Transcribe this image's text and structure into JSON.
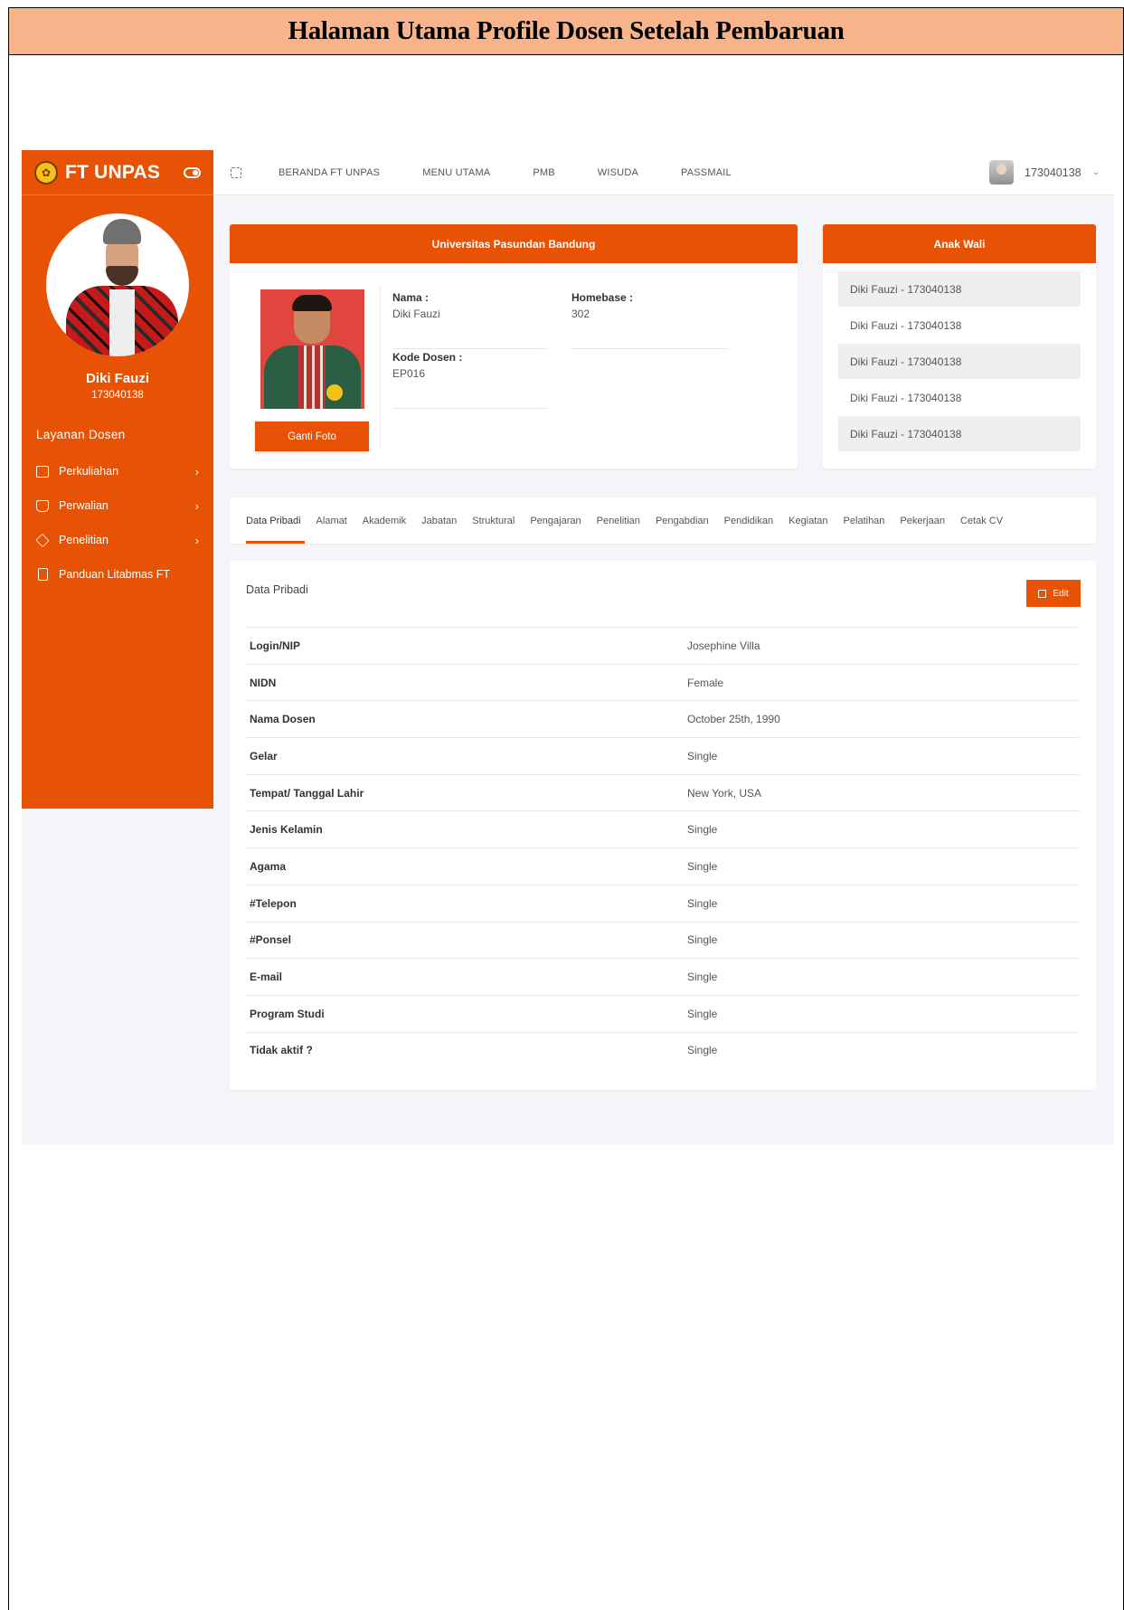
{
  "caption": "Halaman Utama Profile Dosen Setelah Pembaruan",
  "sidebar": {
    "brand": "FT UNPAS",
    "user_name": "Diki Fauzi",
    "user_id": "173040138",
    "section_title": "Layanan Dosen",
    "items": [
      {
        "label": "Perkuliahan",
        "icon": "monitor-icon",
        "has_submenu": true
      },
      {
        "label": "Perwalian",
        "icon": "inbox-icon",
        "has_submenu": true
      },
      {
        "label": "Penelitian",
        "icon": "layers-icon",
        "has_submenu": true
      },
      {
        "label": "Panduan Litabmas FT",
        "icon": "clipboard-icon",
        "has_submenu": false
      }
    ],
    "chevron": "›"
  },
  "topbar": {
    "nav": [
      "BERANDA FT UNPAS",
      "MENU UTAMA",
      "PMB",
      "WISUDA",
      "PASSMAIL"
    ],
    "user_id": "173040138",
    "caret": "⌄"
  },
  "univ_card": {
    "title": "Universitas Pasundan Bandung",
    "photo_button": "Ganti Foto",
    "fields": {
      "nama_label": "Nama :",
      "nama_value": "Diki Fauzi",
      "homebase_label": "Homebase :",
      "homebase_value": "302",
      "kode_label": "Kode Dosen :",
      "kode_value": "EP016"
    }
  },
  "wali_card": {
    "title": "Anak Wali",
    "items": [
      "Diki Fauzi - 173040138",
      "Diki Fauzi - 173040138",
      "Diki Fauzi - 173040138",
      "Diki Fauzi - 173040138",
      "Diki Fauzi - 173040138"
    ]
  },
  "tabs": [
    "Data Pribadi",
    "Alamat",
    "Akademik",
    "Jabatan",
    "Struktural",
    "Pengajaran",
    "Penelitian",
    "Pengabdian",
    "Pendidikan",
    "Kegiatan",
    "Pelatihan",
    "Pekerjaan",
    "Cetak CV"
  ],
  "active_tab": 0,
  "data_card": {
    "title": "Data Pribadi",
    "edit_label": "Edit",
    "rows": [
      {
        "key": "Login/NIP",
        "value": "Josephine Villa"
      },
      {
        "key": "NIDN",
        "value": "Female"
      },
      {
        "key": "Nama Dosen",
        "value": "October 25th, 1990"
      },
      {
        "key": "Gelar",
        "value": "Single"
      },
      {
        "key": "Tempat/ Tanggal Lahir",
        "value": "New York, USA"
      },
      {
        "key": "Jenis Kelamin",
        "value": "Single"
      },
      {
        "key": "Agama",
        "value": "Single"
      },
      {
        "key": "#Telepon",
        "value": "Single"
      },
      {
        "key": "#Ponsel",
        "value": "Single"
      },
      {
        "key": "E-mail",
        "value": "Single"
      },
      {
        "key": "Program Studi",
        "value": "Single"
      },
      {
        "key": "Tidak aktif ?",
        "value": "Single"
      }
    ]
  },
  "colors": {
    "accent": "#e85205",
    "caption_bg": "#f7b48a",
    "app_bg": "#f4f5f8"
  }
}
